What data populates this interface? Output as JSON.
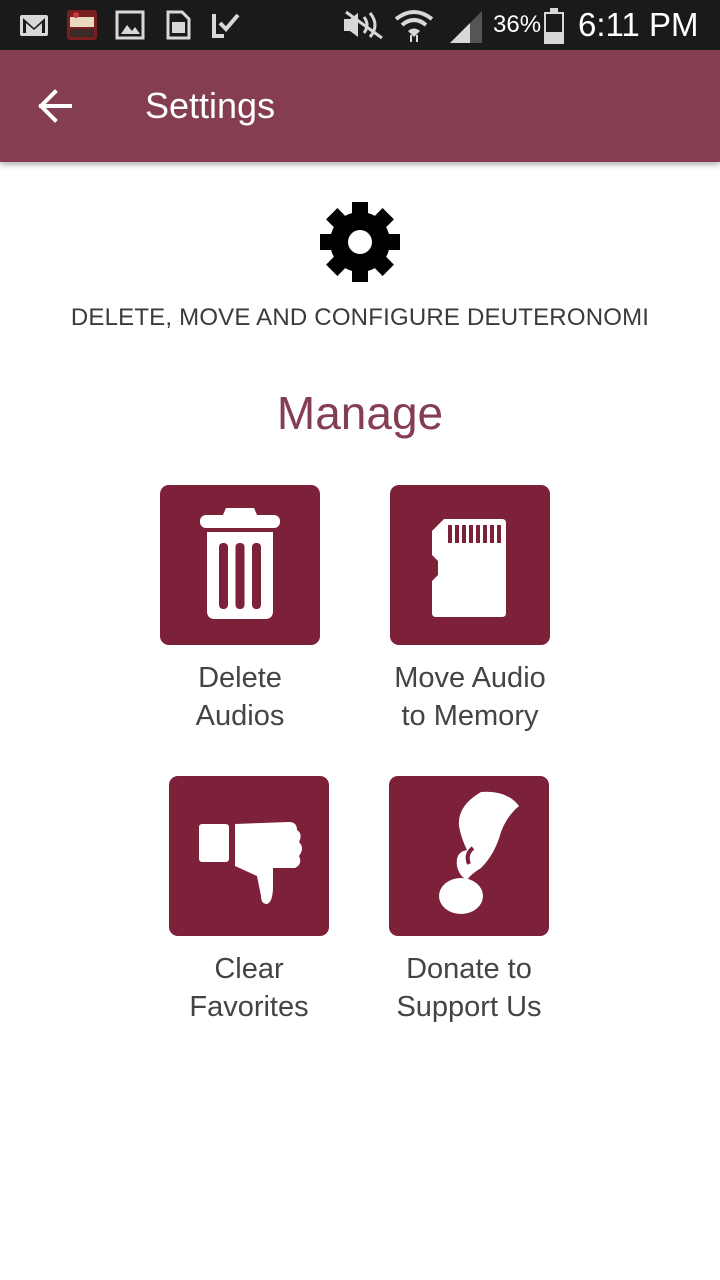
{
  "status_bar": {
    "battery_percent": "36%",
    "time": "6:11 PM",
    "icons": [
      "gmail-icon",
      "app-notification-icon",
      "gallery-icon",
      "sim-card-icon",
      "download-check-icon",
      "mute-icon",
      "wifi-icon",
      "signal-icon",
      "battery-icon"
    ]
  },
  "app_bar": {
    "title": "Settings",
    "back_icon": "back-arrow-icon",
    "background": "#843d51"
  },
  "header": {
    "icon": "gear-icon",
    "subtitle": "DELETE, MOVE AND CONFIGURE DEUTERONOMI",
    "section_title": "Manage"
  },
  "tiles": [
    {
      "icon": "trash-icon",
      "line1": "Delete",
      "line2": "Audios"
    },
    {
      "icon": "sd-card-icon",
      "line1": "Move Audio",
      "line2": "to Memory"
    },
    {
      "icon": "thumbs-down-icon",
      "line1": "Clear",
      "line2": "Favorites"
    },
    {
      "icon": "donate-hand-icon",
      "line1": "Donate to",
      "line2": "Support Us"
    }
  ],
  "colors": {
    "accent": "#843d51",
    "tile": "#7d213b",
    "status_bar": "#1a1a1a"
  }
}
